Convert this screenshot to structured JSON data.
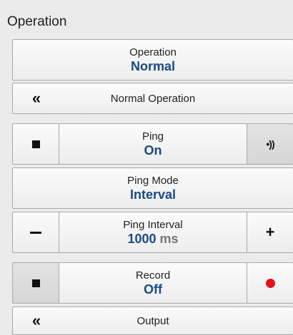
{
  "panel": {
    "title": "Operation"
  },
  "operation": {
    "label": "Operation",
    "value": "Normal"
  },
  "normal_operation": {
    "chevron": "«",
    "label": "Normal Operation"
  },
  "ping": {
    "label": "Ping",
    "value": "On",
    "stop_icon": "stop-icon",
    "ping_icon": "ping-waves-icon",
    "ping_glyph": "•))"
  },
  "ping_mode": {
    "label": "Ping Mode",
    "value": "Interval"
  },
  "ping_interval": {
    "label": "Ping Interval",
    "value": "1000",
    "unit": "ms",
    "plus": "+"
  },
  "record": {
    "label": "Record",
    "value": "Off"
  },
  "output": {
    "chevron": "«",
    "label": "Output"
  },
  "colors": {
    "value_blue": "#1b4a82",
    "record_red": "#e3121b",
    "background": "#ebebeb"
  }
}
